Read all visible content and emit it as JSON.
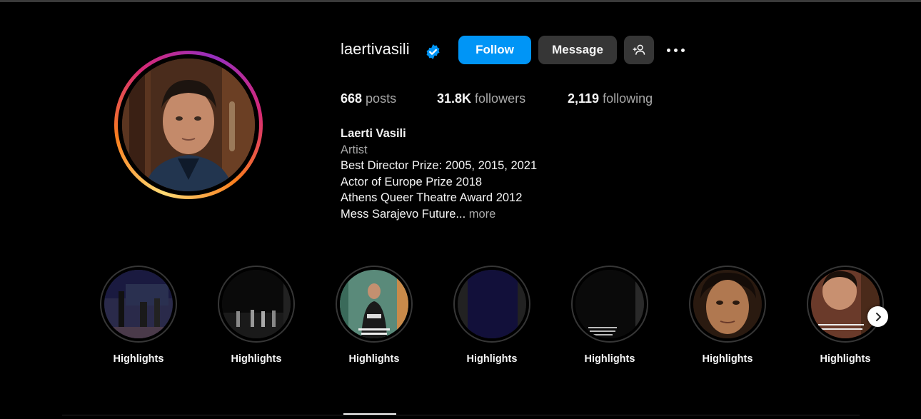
{
  "profile": {
    "username": "laertivasili",
    "verified": true,
    "buttons": {
      "follow": "Follow",
      "message": "Message"
    },
    "stats": {
      "posts_count": "668",
      "posts_label": " posts",
      "followers_count": "31.8K",
      "followers_label": " followers",
      "following_count": "2,119",
      "following_label": " following"
    },
    "bio": {
      "name": "Laerti Vasili",
      "category": "Artist",
      "lines": [
        "Best Director Prize: 2005, 2015, 2021",
        "Actor of Europe Prize 2018",
        "Athens Queer Theatre Award 2012",
        "Mess Sarajevo Future..."
      ],
      "more_label": " more"
    }
  },
  "highlights": [
    {
      "label": "Highlights"
    },
    {
      "label": "Highlights"
    },
    {
      "label": "Highlights"
    },
    {
      "label": "Highlights"
    },
    {
      "label": "Highlights"
    },
    {
      "label": "Highlights"
    },
    {
      "label": "Highlights"
    }
  ],
  "icons": {
    "verified": "verified-badge-icon",
    "add_user": "add-user-icon",
    "more": "more-options-icon",
    "next": "chevron-right-icon"
  },
  "colors": {
    "background": "#000000",
    "follow_button": "#0095f6",
    "secondary_button": "#363636",
    "verified": "#0095f6",
    "muted_text": "#a8a8a8"
  }
}
